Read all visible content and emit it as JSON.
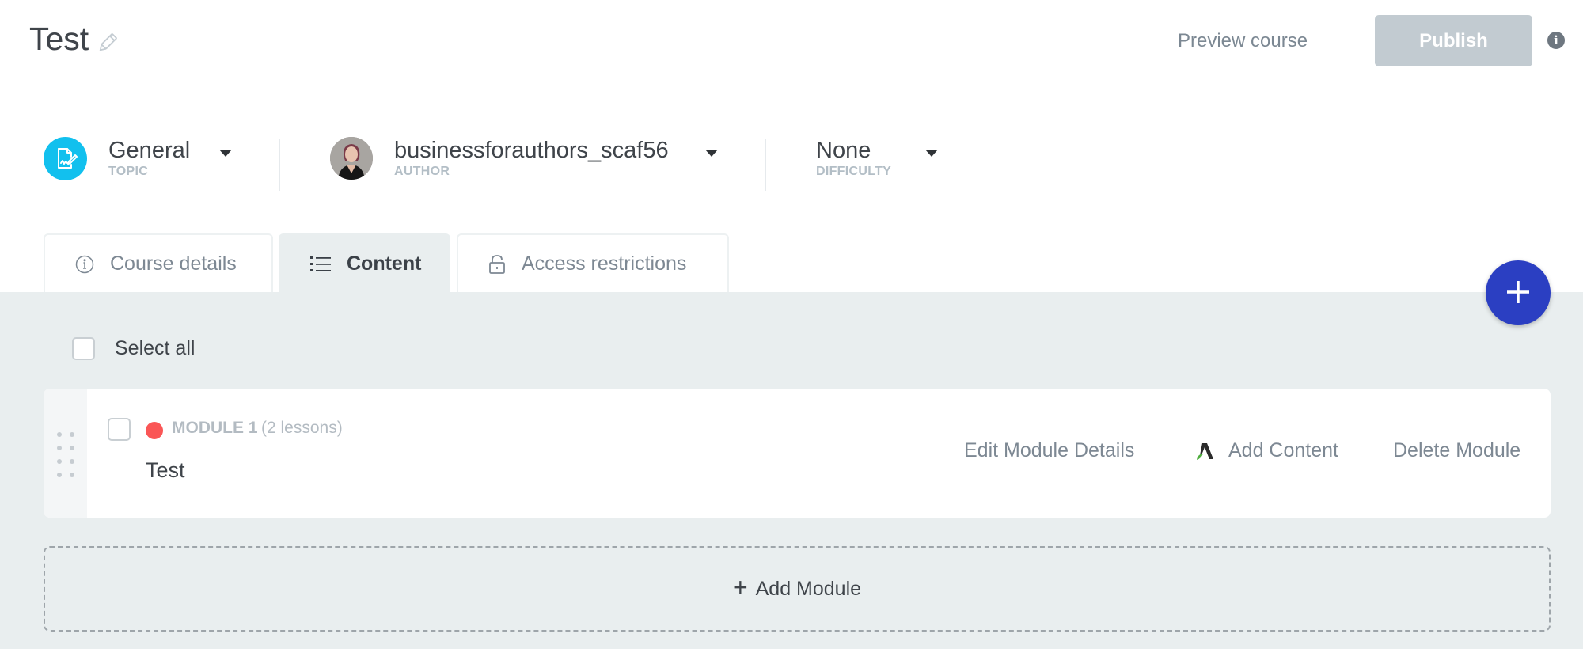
{
  "header": {
    "title": "Test",
    "edit_icon": "pencil-icon",
    "preview_label": "Preview course",
    "publish_label": "Publish",
    "info_icon_glyph": "i"
  },
  "meta": {
    "topic": {
      "value": "General",
      "label": "TOPIC",
      "icon": "signed-document-icon",
      "icon_color": "#12c0ee"
    },
    "author": {
      "value": "businessforauthors_scaf56",
      "label": "AUTHOR",
      "icon": "avatar"
    },
    "difficulty": {
      "value": "None",
      "label": "DIFFICULTY"
    }
  },
  "tabs": [
    {
      "label": "Course details",
      "icon": "info-circle-icon",
      "active": false
    },
    {
      "label": "Content",
      "icon": "list-icon",
      "active": true
    },
    {
      "label": "Access restrictions",
      "icon": "unlock-icon",
      "active": false
    }
  ],
  "content": {
    "select_all_label": "Select all",
    "fab_icon": "plus-icon",
    "modules": [
      {
        "label": "MODULE 1",
        "lesson_count": "(2 lessons)",
        "name": "Test",
        "status_color": "#fa5656",
        "actions": {
          "edit": "Edit Module Details",
          "add_content": "Add Content",
          "delete": "Delete Module"
        }
      }
    ],
    "add_module_label": "Add Module",
    "add_module_glyph": "+"
  },
  "colors": {
    "accent": "#2b3fc2",
    "publish_disabled": "#c2cbd1",
    "content_bg": "#e9eeef"
  }
}
